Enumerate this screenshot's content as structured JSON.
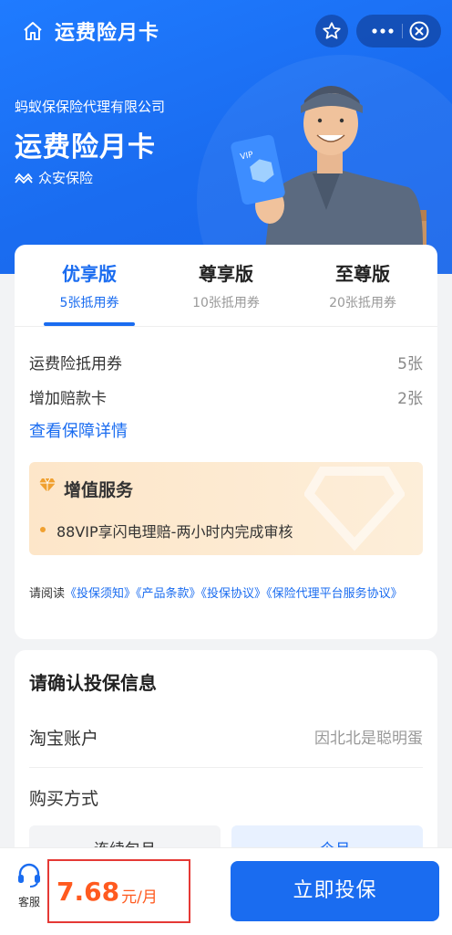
{
  "header": {
    "title": "运费险月卡",
    "company": "蚂蚁保保险代理有限公司",
    "product": "运费险月卡",
    "insurer": "众安保险"
  },
  "plans": {
    "tabs": [
      {
        "name": "优享版",
        "sub": "5张抵用券"
      },
      {
        "name": "尊享版",
        "sub": "10张抵用券"
      },
      {
        "name": "至尊版",
        "sub": "20张抵用券"
      }
    ],
    "selected_index": 0
  },
  "coverage": {
    "rows": [
      {
        "label": "运费险抵用券",
        "value": "5张"
      },
      {
        "label": "增加赔款卡",
        "value": "2张"
      }
    ],
    "detail_link": "查看保障详情"
  },
  "value_added": {
    "title": "增值服务",
    "item": "88VIP享闪电理赔-两小时内完成审核",
    "accent": "#f0a030"
  },
  "agreement": {
    "prefix": "请阅读",
    "docs": [
      "《投保须知》",
      "《产品条款》",
      "《投保协议》",
      "《保险代理平台服务协议》"
    ]
  },
  "confirm": {
    "title": "请确认投保信息",
    "account_label": "淘宝账户",
    "account_value": "因北北是聪明蛋",
    "buy_method_label": "购买方式",
    "options": [
      "连续包月",
      "一个月"
    ]
  },
  "bottom": {
    "service_label": "客服",
    "price": "7.68",
    "unit": "元/月",
    "buy_button": "立即投保"
  },
  "colors": {
    "brand_blue": "#1a6cf0",
    "price_orange": "#ff5a1f",
    "highlight_red": "#e53935"
  }
}
